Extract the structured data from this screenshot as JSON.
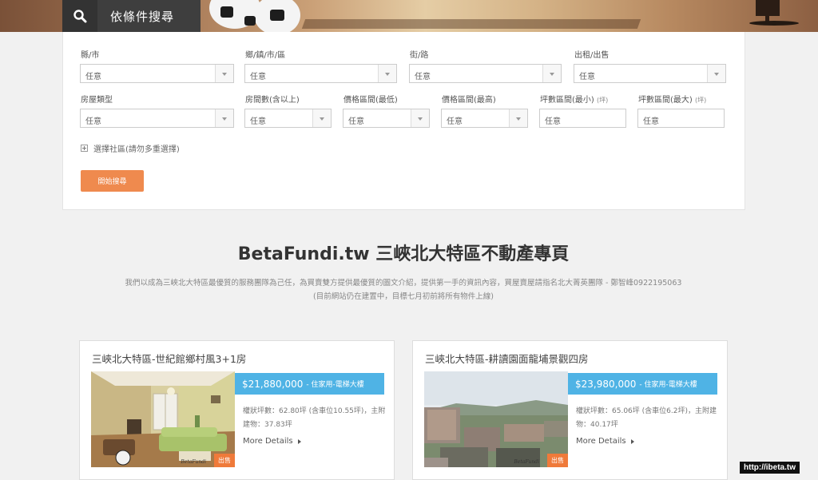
{
  "search_tab": {
    "title": "依條件搜尋"
  },
  "filters": {
    "row1": [
      {
        "label": "縣/市",
        "value": "任意"
      },
      {
        "label": "鄉/鎮/市/區",
        "value": "任意"
      },
      {
        "label": "街/路",
        "value": "任意"
      },
      {
        "label": "出租/出售",
        "value": "任意"
      }
    ],
    "row2": [
      {
        "label": "房屋類型",
        "value": "任意"
      },
      {
        "label": "房間數(含以上)",
        "value": "任意"
      },
      {
        "label": "價格區間(最低)",
        "value": "任意"
      },
      {
        "label": "價格區間(最高)",
        "value": "任意"
      },
      {
        "label": "坪數區間(最小)",
        "unit": "(坪)",
        "value": "任意"
      },
      {
        "label": "坪數區間(最大)",
        "unit": "(坪)",
        "value": "任意"
      }
    ],
    "community": "選擇社區(請勿多重選擇)",
    "search_button": "開始搜尋"
  },
  "intro": {
    "heading": "BetaFundi.tw 三峽北大特區不動產專頁",
    "desc1": "我們以成為三峽北大特區最優質的服務團隊為己任，為買賣雙方提供最優質的圖文介紹，提供第一手的資訊內容，買屋賣屋請指名北大菁英團隊 - 鄭智峰0922195063",
    "desc2": "(目前網站仍在建置中，目標七月初前將所有物件上線)"
  },
  "listings": [
    {
      "title": "三峽北大特區-世紀館鄉村風3+1房",
      "price": "$21,880,000",
      "ptype": "- 住家用-電梯大樓",
      "detail": "權狀坪數：62.80坪 (含車位10.55坪)，主附建物：37.83坪",
      "more": "More Details",
      "badge": "出售",
      "watermark": "BetaFundi"
    },
    {
      "title": "三峽北大特區-耕讀園面龍埔景觀四房",
      "price": "$23,980,000",
      "ptype": "- 住家用-電梯大樓",
      "detail": "權狀坪數：65.06坪 (含車位6.2坪)，主附建物：40.17坪",
      "more": "More Details",
      "badge": "出售",
      "watermark": "BetaFundi"
    }
  ],
  "site_url": "http://ibeta.tw",
  "colors": {
    "accent": "#ef8a4e",
    "price_bar": "#4fb3e5",
    "badge": "#ef7a3a",
    "search_tab": "#3e3e3e"
  }
}
